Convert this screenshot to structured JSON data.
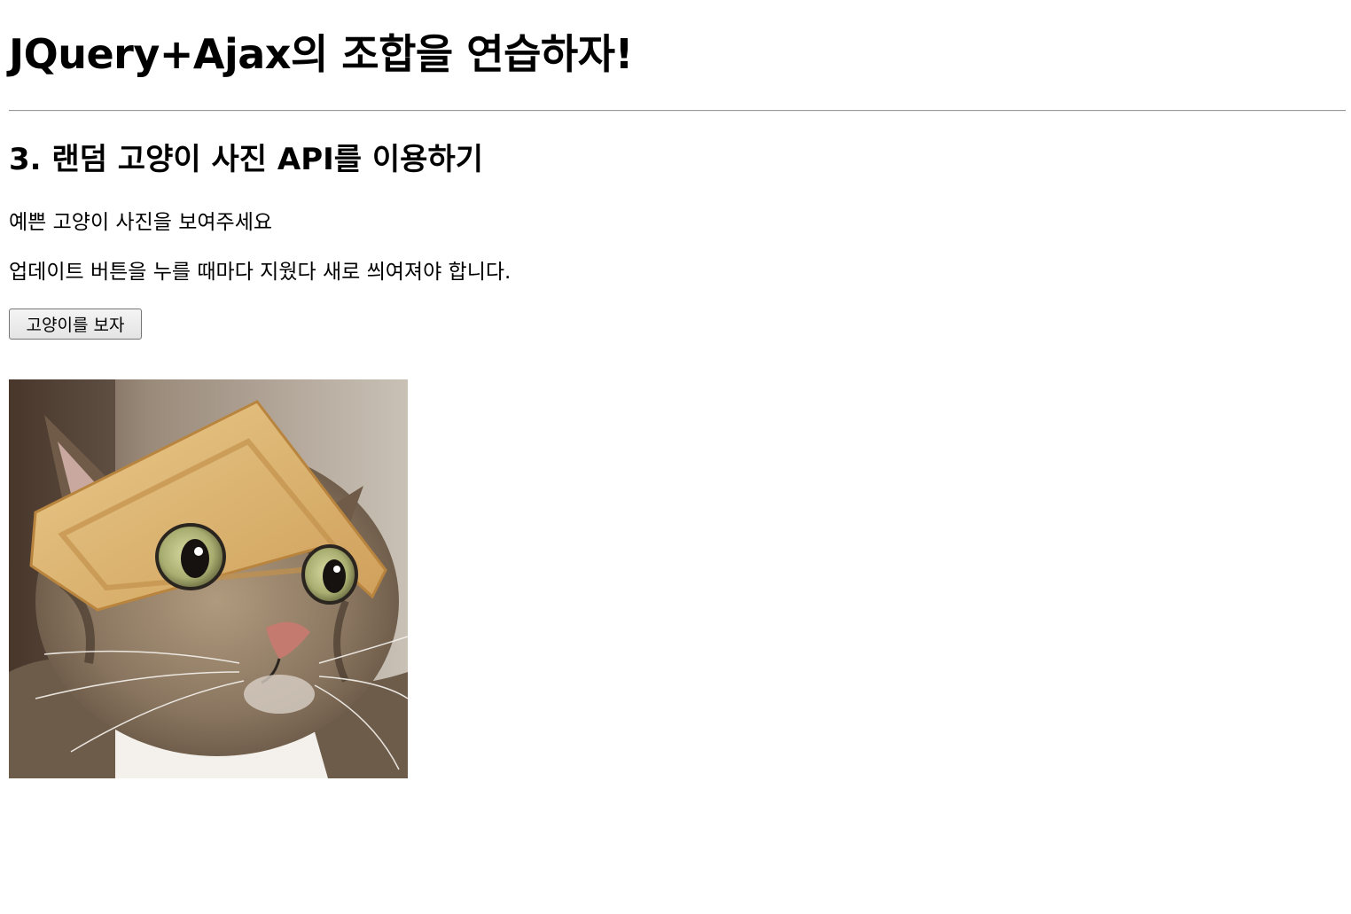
{
  "page": {
    "title": "JQuery+Ajax의 조합을 연습하자!",
    "section_title": "3. 랜덤 고양이 사진 API를 이용하기",
    "description_1": "예쁜 고양이 사진을 보여주세요",
    "description_2": "업데이트 버튼을 누를 때마다 지웠다 새로 씌여져야 합니다.",
    "button_label": "고양이를 보자"
  },
  "image": {
    "subject": "cat-photo"
  },
  "colors": {
    "text": "#000000",
    "background": "#ffffff",
    "divider": "#9a9a9a"
  }
}
